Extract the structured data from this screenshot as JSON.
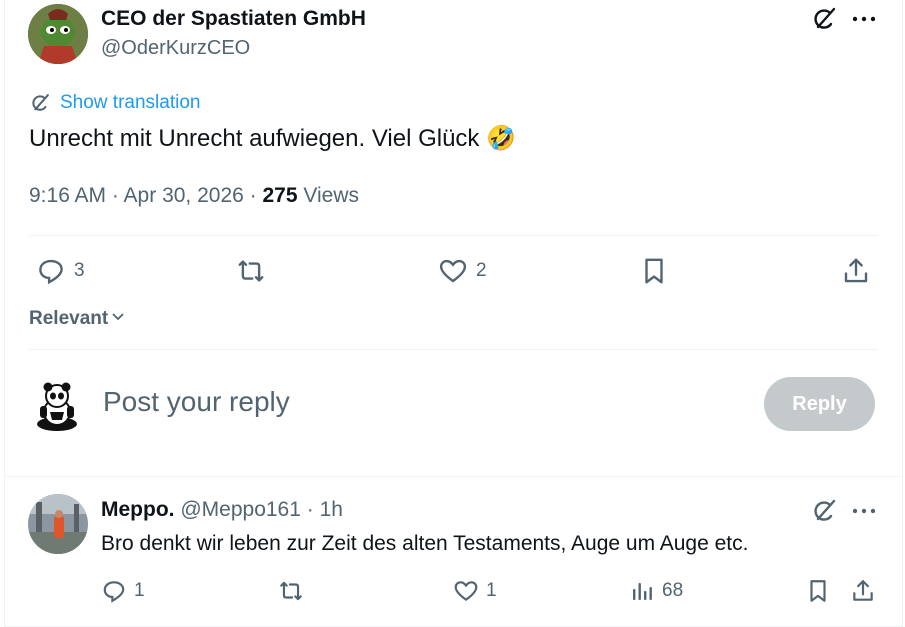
{
  "tweet": {
    "author_name": "CEO der Spastiaten GmbH",
    "author_handle": "@OderKurzCEO",
    "show_translation": "Show translation",
    "text": "Unrecht mit Unrecht aufwiegen. Viel Glück",
    "emoji": "🤣",
    "timestamp": "9:16 AM · Apr 30, 2026 · ",
    "views_count": "275",
    "views_label": " Views",
    "replies": "3",
    "likes": "2"
  },
  "sort": {
    "label": "Relevant"
  },
  "composer": {
    "placeholder": "Post your reply",
    "reply_button": "Reply"
  },
  "reply": {
    "author_name": "Meppo.",
    "author_handle": "@Meppo161",
    "time": " · 1h",
    "text": "Bro denkt wir leben zur Zeit des alten Testaments, Auge um Auge etc.",
    "replies": "1",
    "likes": "1",
    "views": "68"
  },
  "colors": {
    "accent": "#1d9bf0",
    "muted": "#536471",
    "text": "#0f1419",
    "reply_disabled": "#cfd9de"
  }
}
